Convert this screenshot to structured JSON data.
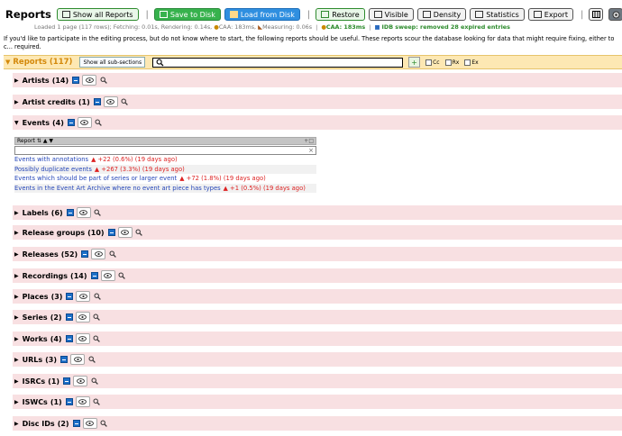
{
  "title": "Reports",
  "toolbar": {
    "show_all_reports": "Show all Reports",
    "save_to_disk": "Save to Disk",
    "load_from_disk": "Load from Disk",
    "restore": "Restore",
    "visible": "Visible",
    "density": "Density",
    "statistics": "Statistics",
    "export": "Export"
  },
  "status": {
    "load_info": "Loaded 1 page (117 rows); Fetching: 0.01s, Rendering: 0.14s,",
    "caa_timing": "CAA: 183ms,",
    "measuring": "Measuring: 0.06s",
    "caa_result": "CAA: 183ms",
    "idb_sweep": "IDB sweep: removed 28 expired entries"
  },
  "description": "If you'd like to participate in the editing process, but do not know where to start, the following reports should be useful. These reports scour the database looking for data that might require fixing, either to c... required.",
  "reports_header": {
    "label": "Reports",
    "count": "(117)",
    "show_all_sub": "Show all sub-sections",
    "search_value": "",
    "cc_label": "Cc",
    "rx_label": "Rx",
    "ex_label": "Ex"
  },
  "sections": [
    {
      "name": "Artists",
      "count": "(14)"
    },
    {
      "name": "Artist credits",
      "count": "(1)"
    },
    {
      "name": "Events",
      "count": "(4)"
    },
    {
      "name": "Labels",
      "count": "(6)"
    },
    {
      "name": "Release groups",
      "count": "(10)"
    },
    {
      "name": "Releases",
      "count": "(52)"
    },
    {
      "name": "Recordings",
      "count": "(14)"
    },
    {
      "name": "Places",
      "count": "(3)"
    },
    {
      "name": "Series",
      "count": "(2)"
    },
    {
      "name": "Works",
      "count": "(4)"
    },
    {
      "name": "URLs",
      "count": "(3)"
    },
    {
      "name": "ISRCs",
      "count": "(1)"
    },
    {
      "name": "ISWCs",
      "count": "(1)"
    },
    {
      "name": "Disc IDs",
      "count": "(2)"
    }
  ],
  "events_table": {
    "header": "Report",
    "rows": [
      {
        "name": "Events with annotations",
        "change": "▲ +22 (0.6%) (19 days ago)"
      },
      {
        "name": "Possibly duplicate events",
        "change": "▲ +267 (3.3%) (19 days ago)"
      },
      {
        "name": "Events which should be part of series or larger event",
        "change": "▲ +72 (1.8%) (19 days ago)"
      },
      {
        "name": "Events in the Event Art Archive where no event art piece has types",
        "change": "▲ +1 (0.5%) (19 days ago)"
      }
    ]
  },
  "colors": {
    "section_bg": "#f8e0e2",
    "header_bg": "#fde8b3",
    "accent_orange": "#d4890b",
    "link_blue": "#2546b8",
    "change_red": "#dd2222"
  }
}
